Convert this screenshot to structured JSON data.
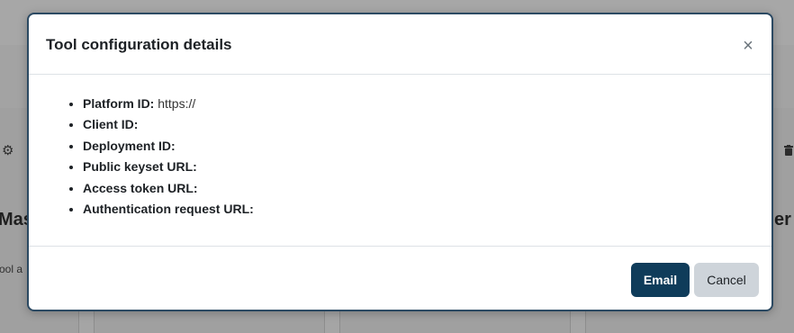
{
  "background": {
    "left_heading": "Mast",
    "left_text": "ool a",
    "right_heading": "er",
    "left_icon": "gear-icon",
    "right_icon": "trash-icon"
  },
  "modal": {
    "title": "Tool configuration details",
    "close_icon": "close-icon",
    "close_glyph": "×",
    "items": [
      {
        "label": "Platform ID:",
        "value": "https://"
      },
      {
        "label": "Client ID:",
        "value": ""
      },
      {
        "label": "Deployment ID:",
        "value": ""
      },
      {
        "label": "Public keyset URL:",
        "value": ""
      },
      {
        "label": "Access token URL:",
        "value": ""
      },
      {
        "label": "Authentication request URL:",
        "value": ""
      }
    ],
    "email_label": "Email",
    "cancel_label": "Cancel"
  },
  "colors": {
    "primary_button": "#0f3c5a",
    "secondary_button": "#ced4da",
    "modal_border": "#2c4a63"
  }
}
